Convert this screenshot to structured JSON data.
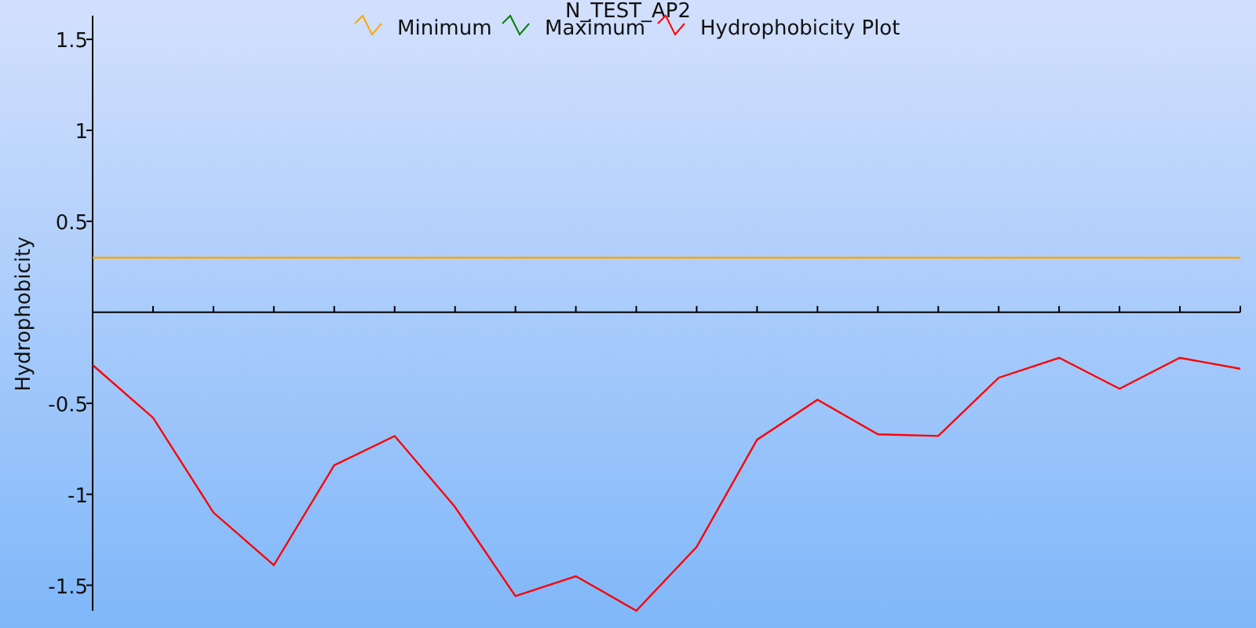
{
  "chart_data": {
    "type": "line",
    "title": "N_TEST_AP2",
    "ylabel": "Hydrophobicity",
    "categories": [
      null,
      null,
      null,
      null,
      null,
      null,
      null,
      null,
      null,
      null,
      null,
      null,
      null,
      null,
      null,
      null,
      null,
      null,
      null,
      null
    ],
    "legend": "top",
    "ylim": [
      -1.64,
      1.63
    ],
    "yticks": [
      1.5,
      1,
      0.5,
      -0.5,
      -1,
      -1.5
    ],
    "series": [
      {
        "name": "Minimum",
        "color": "#ffa500",
        "values": [
          0.3,
          0.3,
          0.3,
          0.3,
          0.3,
          0.3,
          0.3,
          0.3,
          0.3,
          0.3,
          0.3,
          0.3,
          0.3,
          0.3,
          0.3,
          0.3,
          0.3,
          0.3,
          0.3,
          0.3
        ]
      },
      {
        "name": "Maximum",
        "color": "#008000",
        "values": [
          null,
          null,
          null,
          null,
          null,
          null,
          null,
          null,
          null,
          null,
          null,
          null,
          null,
          null,
          null,
          null,
          null,
          null,
          null,
          null
        ]
      },
      {
        "name": "Hydrophobicity Plot",
        "color": "#ff0000",
        "values": [
          -0.29,
          -0.58,
          -1.1,
          -1.39,
          -0.84,
          -0.68,
          -1.07,
          -1.56,
          -1.45,
          -1.64,
          -1.29,
          -0.7,
          -0.48,
          -0.67,
          -0.68,
          -0.36,
          -0.25,
          -0.42,
          -0.25,
          -0.31
        ]
      }
    ]
  }
}
